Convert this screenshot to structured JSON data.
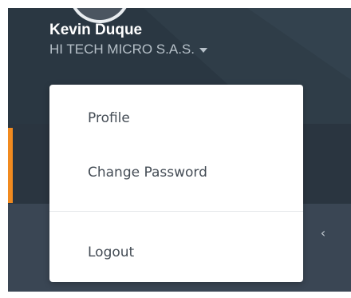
{
  "user": {
    "name": "Kevin Duque",
    "company": "HI TECH MICRO S.A.S."
  },
  "dropdown": {
    "items": [
      {
        "label": "Profile"
      },
      {
        "label": "Change Password"
      },
      {
        "label": "Logout"
      }
    ]
  },
  "sidebar": {
    "collapse_glyph": "‹"
  },
  "colors": {
    "sidebar_bg": "#2b3540",
    "lower_bg": "#3a4654",
    "accent": "#f18a1f",
    "dropdown_bg": "#ffffff",
    "menu_text": "#444c55",
    "name_text": "#ffffff",
    "company_text": "#b6c0c8"
  },
  "icons": {
    "company_caret": "caret-down-icon",
    "collapse": "chevron-left-icon"
  }
}
